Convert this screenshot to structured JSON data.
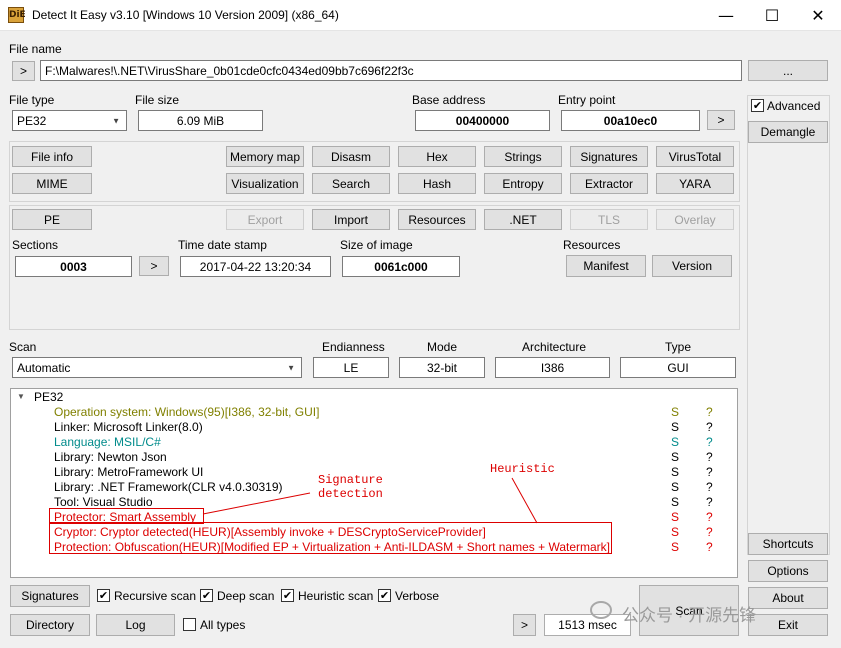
{
  "window": {
    "title": "Detect It Easy v3.10 [Windows 10 Version 2009] (x86_64)",
    "icon_text": "DiE",
    "minimize_glyph": "—",
    "maximize_glyph": "☐",
    "close_glyph": "✕"
  },
  "file": {
    "label": "File name",
    "browse_left": ">",
    "path": "F:\\Malwares!\\.NET\\VirusShare_0b01cde0cfc0434ed09bb7c696f22f3c",
    "browse_button": "..."
  },
  "info": {
    "file_type_label": "File type",
    "file_type": "PE32",
    "file_size_label": "File size",
    "file_size": "6.09 MiB",
    "base_address_label": "Base address",
    "base_address": "00400000",
    "entry_point_label": "Entry point",
    "entry_point": "00a10ec0",
    "entry_point_btn": ">"
  },
  "side": {
    "advanced_label": "Advanced",
    "advanced_checked": "✔",
    "demangle": "Demangle",
    "shortcuts": "Shortcuts",
    "options": "Options",
    "about": "About",
    "exit": "Exit"
  },
  "tools": {
    "file_info": "File info",
    "mime": "MIME",
    "memory_map": "Memory map",
    "disasm": "Disasm",
    "hex": "Hex",
    "strings": "Strings",
    "signatures": "Signatures",
    "virustotal": "VirusTotal",
    "visualization": "Visualization",
    "search": "Search",
    "hash": "Hash",
    "entropy": "Entropy",
    "extractor": "Extractor",
    "yara": "YARA"
  },
  "pe": {
    "pe_btn": "PE",
    "export": "Export",
    "import": "Import",
    "resources": "Resources",
    "net": ".NET",
    "tls": "TLS",
    "overlay": "Overlay",
    "sections_label": "Sections",
    "sections": "0003",
    "sections_btn": ">",
    "timestamp_label": "Time date stamp",
    "timestamp": "2017-04-22 13:20:34",
    "size_label": "Size of image",
    "size": "0061c000",
    "resources_label": "Resources",
    "manifest": "Manifest",
    "version": "Version"
  },
  "scan": {
    "scan_label": "Scan",
    "scan_mode": "Automatic",
    "endianness_label": "Endianness",
    "endianness": "LE",
    "mode_label": "Mode",
    "mode": "32-bit",
    "arch_label": "Architecture",
    "arch": "I386",
    "type_label": "Type",
    "type": "GUI"
  },
  "results": {
    "root": "PE32",
    "rows": [
      {
        "text": "Operation system: Windows(95)[I386, 32-bit, GUI]",
        "s": "S",
        "q": "?",
        "color": "#808000"
      },
      {
        "text": "Linker: Microsoft Linker(8.0)",
        "s": "S",
        "q": "?",
        "color": "#000000"
      },
      {
        "text": "Language: MSIL/C#",
        "s": "S",
        "q": "?",
        "color": "#008b8b"
      },
      {
        "text": "Library: Newton Json",
        "s": "S",
        "q": "?",
        "color": "#000000"
      },
      {
        "text": "Library: MetroFramework UI",
        "s": "S",
        "q": "?",
        "color": "#000000"
      },
      {
        "text": "Library: .NET Framework(CLR v4.0.30319)",
        "s": "S",
        "q": "?",
        "color": "#000000"
      },
      {
        "text": "Tool: Visual Studio",
        "s": "S",
        "q": "?",
        "color": "#000000"
      },
      {
        "text": "Protector: Smart Assembly",
        "s": "S",
        "q": "?",
        "color": "#dc0000"
      },
      {
        "text": "Cryptor: Cryptor detected(HEUR)[Assembly invoke + DESCryptoServiceProvider]",
        "s": "S",
        "q": "?",
        "color": "#dc0000"
      },
      {
        "text": "Protection: Obfuscation(HEUR)[Modified EP + Virtualization + Anti-ILDASM + Short names + Watermark]",
        "s": "S",
        "q": "?",
        "color": "#dc0000"
      }
    ],
    "annotation_signature": "Signature\ndetection",
    "annotation_heuristic": "Heuristic"
  },
  "bottom": {
    "signatures": "Signatures",
    "recursive": "Recursive scan",
    "deep": "Deep scan",
    "heuristic": "Heuristic scan",
    "verbose": "Verbose",
    "directory": "Directory",
    "log": "Log",
    "all_types": "All types",
    "arrow": ">",
    "time": "1513 msec",
    "scan": "Scan",
    "check_glyph": "✔"
  },
  "watermark": {
    "text": "公众号 · 开源先锋"
  },
  "colors": {
    "olive": "#808000",
    "teal": "#008b8b",
    "red": "#dc0000"
  }
}
